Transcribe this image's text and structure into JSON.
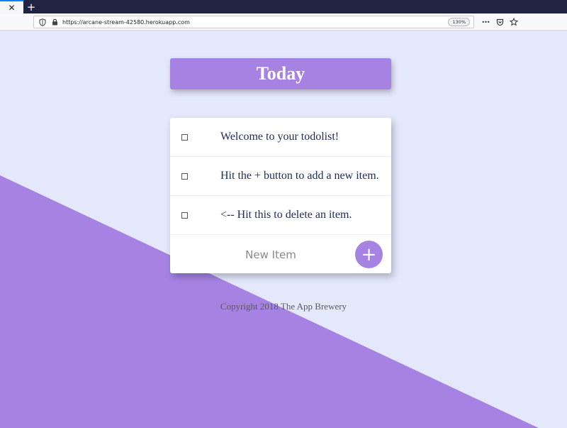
{
  "browser": {
    "tab_close": "✕",
    "new_tab": "+",
    "url": "https://arcane-stream-42580.herokuapp.com",
    "zoom": "130%",
    "more_actions": "•••",
    "icons": [
      "tracking-shield-icon",
      "lock-icon",
      "more-actions-icon",
      "pocket-icon",
      "bookmark-star-icon"
    ]
  },
  "page": {
    "title": "Today",
    "items": [
      {
        "text": "Welcome to your todolist!",
        "checked": false
      },
      {
        "text": "Hit the + button to add a new item.",
        "checked": false
      },
      {
        "text": "<-- Hit this to delete an item.",
        "checked": false
      }
    ],
    "new_item_placeholder": "New Item",
    "add_button_label": "+",
    "footer": "Copyright 2018 The App Brewery"
  },
  "colors": {
    "background": "#e4e8fb",
    "accent": "#a683e3",
    "item_text": "#1d2a55",
    "tabstrip": "#1f2442"
  }
}
